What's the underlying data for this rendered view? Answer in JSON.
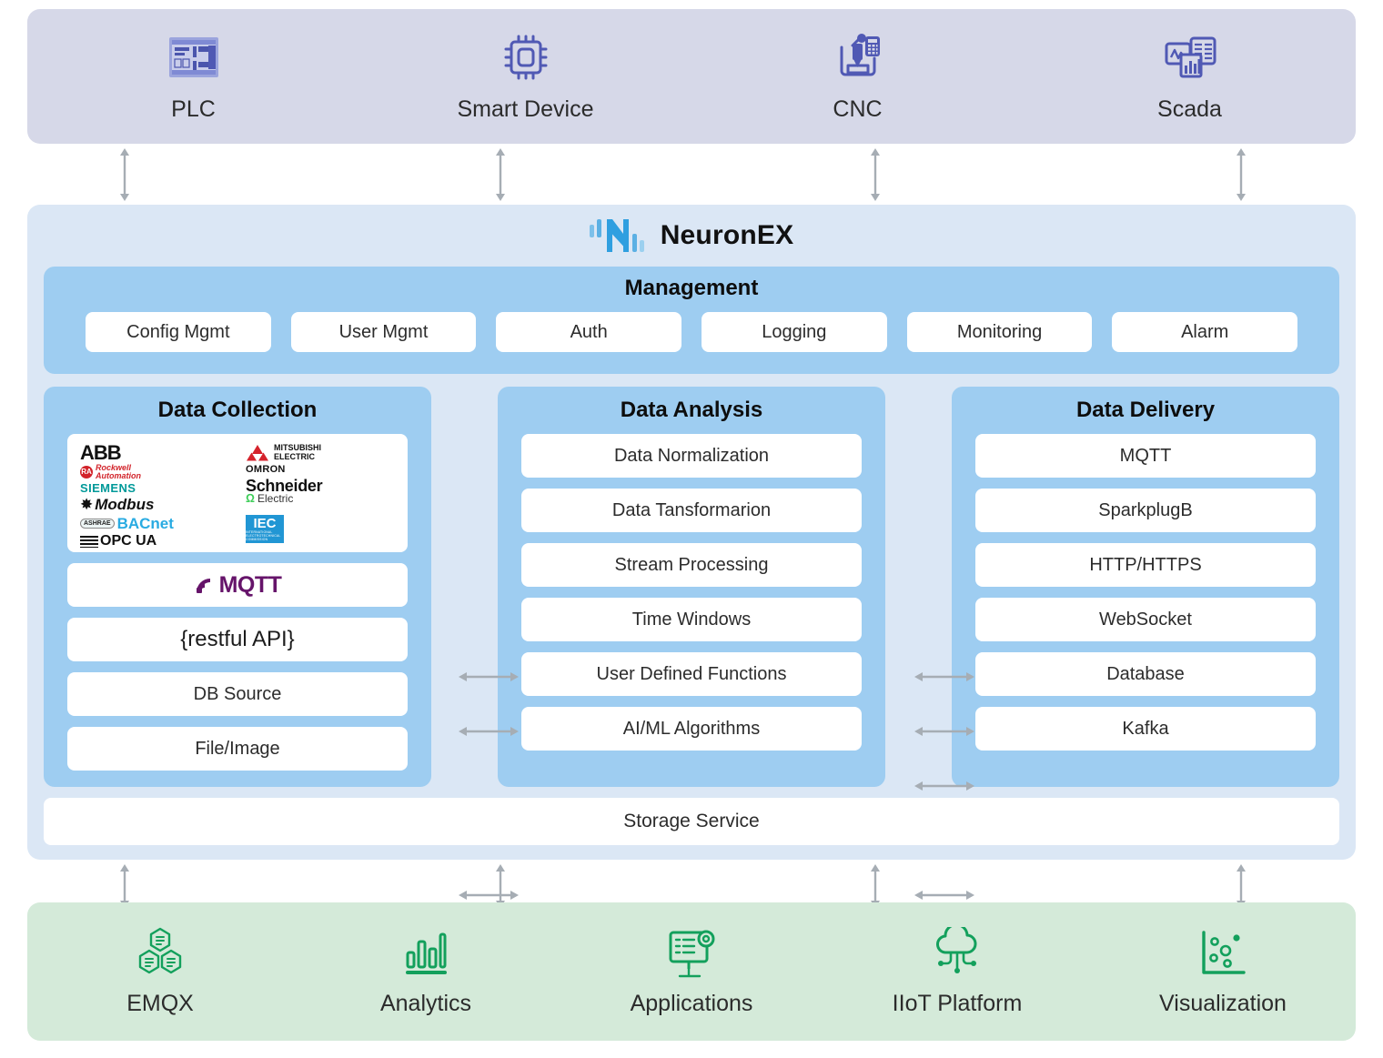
{
  "devices": {
    "items": [
      {
        "label": "PLC",
        "icon": "plc-icon"
      },
      {
        "label": "Smart Device",
        "icon": "chip-icon"
      },
      {
        "label": "CNC",
        "icon": "cnc-machine-icon"
      },
      {
        "label": "Scada",
        "icon": "scada-dashboard-icon"
      }
    ]
  },
  "platform": {
    "title": "NeuronEX",
    "logo_icon": "neuronex-logo-icon",
    "management": {
      "title": "Management",
      "chips": [
        "Config Mgmt",
        "User Mgmt",
        "Auth",
        "Logging",
        "Monitoring",
        "Alarm"
      ]
    },
    "data_collection": {
      "title": "Data Collection",
      "brand_logos_left": [
        "ABB",
        "Rockwell Automation",
        "SIEMENS",
        "Modbus",
        "BACnet",
        "OPC UA"
      ],
      "brand_logos_right": [
        "MITSUBISHI ELECTRIC",
        "OMRON",
        "Schneider Electric",
        "IEC"
      ],
      "brands": {
        "abb": "ABB",
        "rockwell_initials": "RA",
        "rockwell_line1": "Rockwell",
        "rockwell_line2": "Automation",
        "siemens": "SIEMENS",
        "modbus": "Modbus",
        "bacnet_mark": "ASHRAE",
        "bacnet": "BACnet",
        "opcua": "OPC UA",
        "mitsubishi_line1": "MITSUBISHI",
        "mitsubishi_line2": "ELECTRIC",
        "omron": "OMRON",
        "schneider_line1": "Schneider",
        "schneider_line2": "Electric",
        "iec": "IEC",
        "iec_sub": "INTERNATIONAL ELECTROTECHNICAL COMMISSION"
      },
      "mqtt_label": "MQTT",
      "mqtt_icon": "mqtt-signal-icon",
      "restful_label": "{restful API}",
      "items": [
        "DB Source",
        "File/Image"
      ]
    },
    "data_analysis": {
      "title": "Data Analysis",
      "items": [
        "Data Normalization",
        "Data Tansformarion",
        "Stream Processing",
        "Time Windows",
        "User Defined Functions",
        "AI/ML Algorithms"
      ]
    },
    "data_delivery": {
      "title": "Data Delivery",
      "items": [
        "MQTT",
        "SparkplugB",
        "HTTP/HTTPS",
        "WebSocket",
        "Database",
        "Kafka"
      ]
    },
    "storage_service": "Storage Service"
  },
  "consumers": {
    "items": [
      {
        "label": "EMQX",
        "icon": "hexagon-cluster-icon"
      },
      {
        "label": "Analytics",
        "icon": "bar-chart-icon"
      },
      {
        "label": "Applications",
        "icon": "screen-gear-icon"
      },
      {
        "label": "IIoT Platform",
        "icon": "cloud-nodes-icon"
      },
      {
        "label": "Visualization",
        "icon": "scatter-plot-icon"
      }
    ]
  },
  "colors": {
    "device_band_bg": "#d6d8e8",
    "device_icon": "#5059b4",
    "panel_bg": "#dbe7f5",
    "section_bg": "#9ecdf1",
    "card_bg": "#ffffff",
    "green_band_bg": "#d4ead9",
    "green_icon": "#13a05c",
    "arrow": "#a6adb4",
    "mqtt_purple": "#66146a",
    "logo_blue": "#2f9fe0"
  }
}
